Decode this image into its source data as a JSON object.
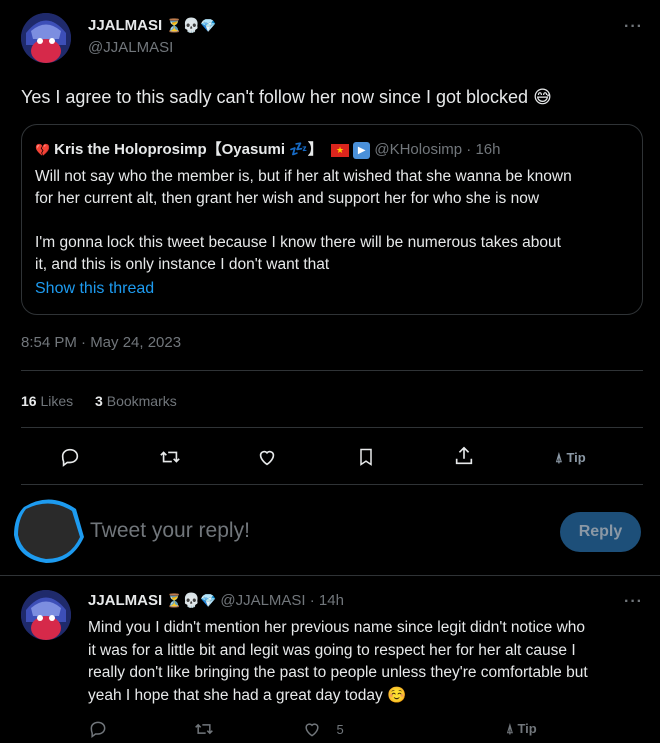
{
  "main_tweet": {
    "author_name": "JJALMASI",
    "author_handle": "@JJALMASI",
    "name_badges": [
      "hourglass",
      "skull",
      "gem"
    ],
    "text": "Yes I agree to this sadly can't follow her now since I got blocked",
    "text_emoji": "😅",
    "timestamp": "8:54 PM · May 24, 2023",
    "stats": {
      "likes_count": "16",
      "likes_label": "Likes",
      "bookmarks_count": "3",
      "bookmarks_label": "Bookmarks"
    },
    "more_label": "···"
  },
  "quoted_tweet": {
    "author_name": "Kris the Holoprosimp【Oyasumi 💤】",
    "author_handle": "@KHolosimp",
    "time_ago": "· 16h",
    "flags": [
      "broken-heart",
      "vietnam-flag",
      "play-button"
    ],
    "text_line1": "Will not say who the member is, but if her alt wished that she wanna be known",
    "text_line2": "for her current alt, then grant her wish and support her for who she is now",
    "text_line3": "I'm gonna lock this tweet because I know there will be numerous takes about",
    "text_line4": "it, and this is only instance I don't want that",
    "show_thread": "Show this thread"
  },
  "action_bar": {
    "icons": [
      "reply-icon",
      "retweet-icon",
      "like-icon",
      "bookmark-icon",
      "share-icon"
    ],
    "tip_label": "Tip"
  },
  "composer": {
    "placeholder": "Tweet your reply!",
    "reply_button": "Reply"
  },
  "reply_tweet": {
    "author_name": "JJALMASI",
    "author_handle": "@JJALMASI",
    "time_ago": "· 14h",
    "text_line1": "Mind you I didn't mention her previous name since legit didn't notice who",
    "text_line2": "it was for a little bit and legit was going to respect her for her alt cause I",
    "text_line3": "really don't like bringing the past to people unless they're comfortable but",
    "text_line4": "yeah I hope that she had a great day today",
    "text_emoji": "☺️",
    "like_count": "5",
    "tip_label": "Tip",
    "more_label": "···"
  },
  "colors": {
    "background": "#000000",
    "text": "#e7e9ea",
    "muted": "#71767b",
    "link": "#1d9bf0",
    "border": "#2f3336",
    "reply_button_bg": "#1d4f79"
  }
}
